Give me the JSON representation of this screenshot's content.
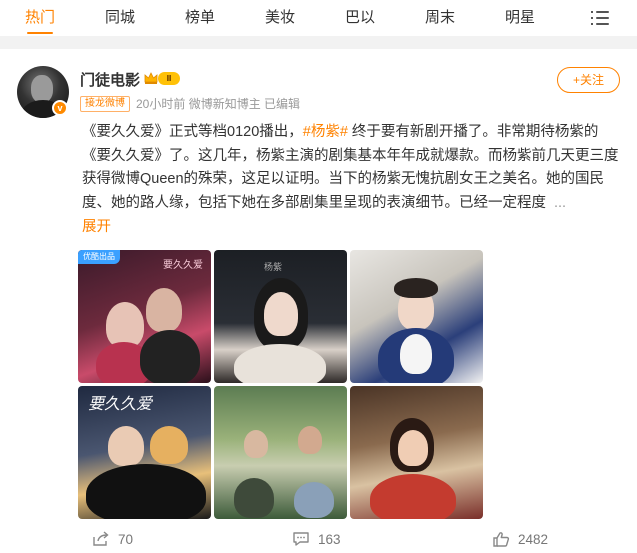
{
  "tabs": [
    {
      "label": "热门",
      "active": true
    },
    {
      "label": "同城",
      "active": false
    },
    {
      "label": "榜单",
      "active": false
    },
    {
      "label": "美妆",
      "active": false
    },
    {
      "label": "巴以",
      "active": false
    },
    {
      "label": "周末",
      "active": false
    },
    {
      "label": "明星",
      "active": false
    }
  ],
  "post": {
    "author": "门徒电影",
    "level_badge": "Ⅱ",
    "verified_icon": "v-badge-icon",
    "tag": "接龙微博",
    "time": "20小时前",
    "meta": "微博新知博主 已编辑",
    "follow_label": "+关注",
    "text_part1": "《要久久爱》正式等档0120播出，",
    "hashtag": "#杨紫#",
    "text_part2": " 终于要有新剧开播了。非常期待杨紫的《要久久爱》了。这几年，杨紫主演的剧集基本年年成就爆款。而杨紫前几天更三度获得微博Queen的殊荣，这足以证明。当下的杨紫无愧抗剧女王之美名。她的国民度、她的路人缘，包括下她在多部剧集里呈现的表演细节。已经一定程度",
    "ellipsis": "...",
    "expand_label": "展开",
    "images": [
      {
        "corner_tag": "优酷出品",
        "caption": "要久久爱"
      },
      {
        "caption": "杨紫"
      },
      {
        "caption": ""
      },
      {
        "caption": "要久久爱"
      },
      {
        "caption": ""
      },
      {
        "caption": ""
      }
    ],
    "stats": {
      "shares": "70",
      "comments": "163",
      "likes": "2482"
    }
  },
  "colors": {
    "accent": "#ff8200",
    "text": "#333333",
    "muted": "#999999"
  }
}
